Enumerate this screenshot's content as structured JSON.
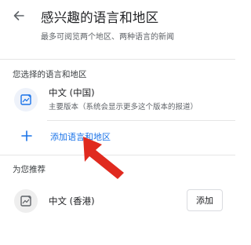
{
  "header": {
    "title": "感兴趣的语言和地区",
    "subtitle": "最多可阅览两个地区、两种语言的新闻",
    "back_icon": "arrow-back-icon"
  },
  "selected_section": {
    "label": "您选择的语言和地区",
    "items": [
      {
        "name": "中文 (中国)",
        "description": "主要版本（系统会显示更多这个版本的报道）",
        "icon": "news-language-icon"
      }
    ]
  },
  "add_action": {
    "label": "添加语言和地区",
    "icon": "plus-icon"
  },
  "recommended_section": {
    "label": "为您推荐",
    "items": [
      {
        "name": "中文 (香港)",
        "button_label": "添加",
        "icon": "news-language-icon"
      }
    ]
  },
  "colors": {
    "accent": "#1a73e8",
    "annotation_arrow": "#e02a1f",
    "text_primary": "#202124",
    "text_secondary": "#5f6368"
  }
}
